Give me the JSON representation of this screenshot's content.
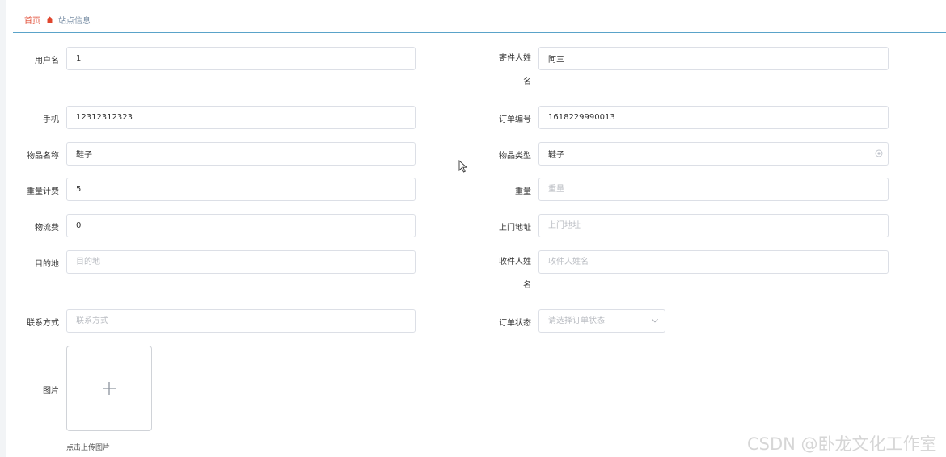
{
  "breadcrumb": {
    "home": "首页",
    "current": "站点信息"
  },
  "form": {
    "username": {
      "label": "用户名",
      "value": "1",
      "placeholder": ""
    },
    "sender_name": {
      "label": "寄件人姓名",
      "value": "阿三",
      "placeholder": ""
    },
    "phone": {
      "label": "手机",
      "value": "12312312323",
      "placeholder": ""
    },
    "order_no": {
      "label": "订单编号",
      "value": "1618229990013",
      "placeholder": ""
    },
    "item_name": {
      "label": "物品名称",
      "value": "鞋子",
      "placeholder": ""
    },
    "item_type": {
      "label": "物品类型",
      "value": "鞋子",
      "placeholder": ""
    },
    "weight_fee": {
      "label": "重量计费",
      "value": "5",
      "placeholder": ""
    },
    "weight": {
      "label": "重量",
      "value": "",
      "placeholder": "重量"
    },
    "logistics_fee": {
      "label": "物流费",
      "value": "0",
      "placeholder": ""
    },
    "pickup_addr": {
      "label": "上门地址",
      "value": "",
      "placeholder": "上门地址"
    },
    "destination": {
      "label": "目的地",
      "value": "",
      "placeholder": "目的地"
    },
    "receiver_name": {
      "label": "收件人姓名",
      "value": "",
      "placeholder": "收件人姓名"
    },
    "contact": {
      "label": "联系方式",
      "value": "",
      "placeholder": "联系方式"
    },
    "order_status": {
      "label": "订单状态",
      "value": "",
      "placeholder": "请选择订单状态"
    },
    "image": {
      "label": "图片",
      "upload_hint": "点击上传图片"
    }
  },
  "watermark": "CSDN @卧龙文化工作室",
  "colors": {
    "accent": "#e0462e",
    "divider": "#5aa3c9",
    "border": "#dcdfe6"
  }
}
